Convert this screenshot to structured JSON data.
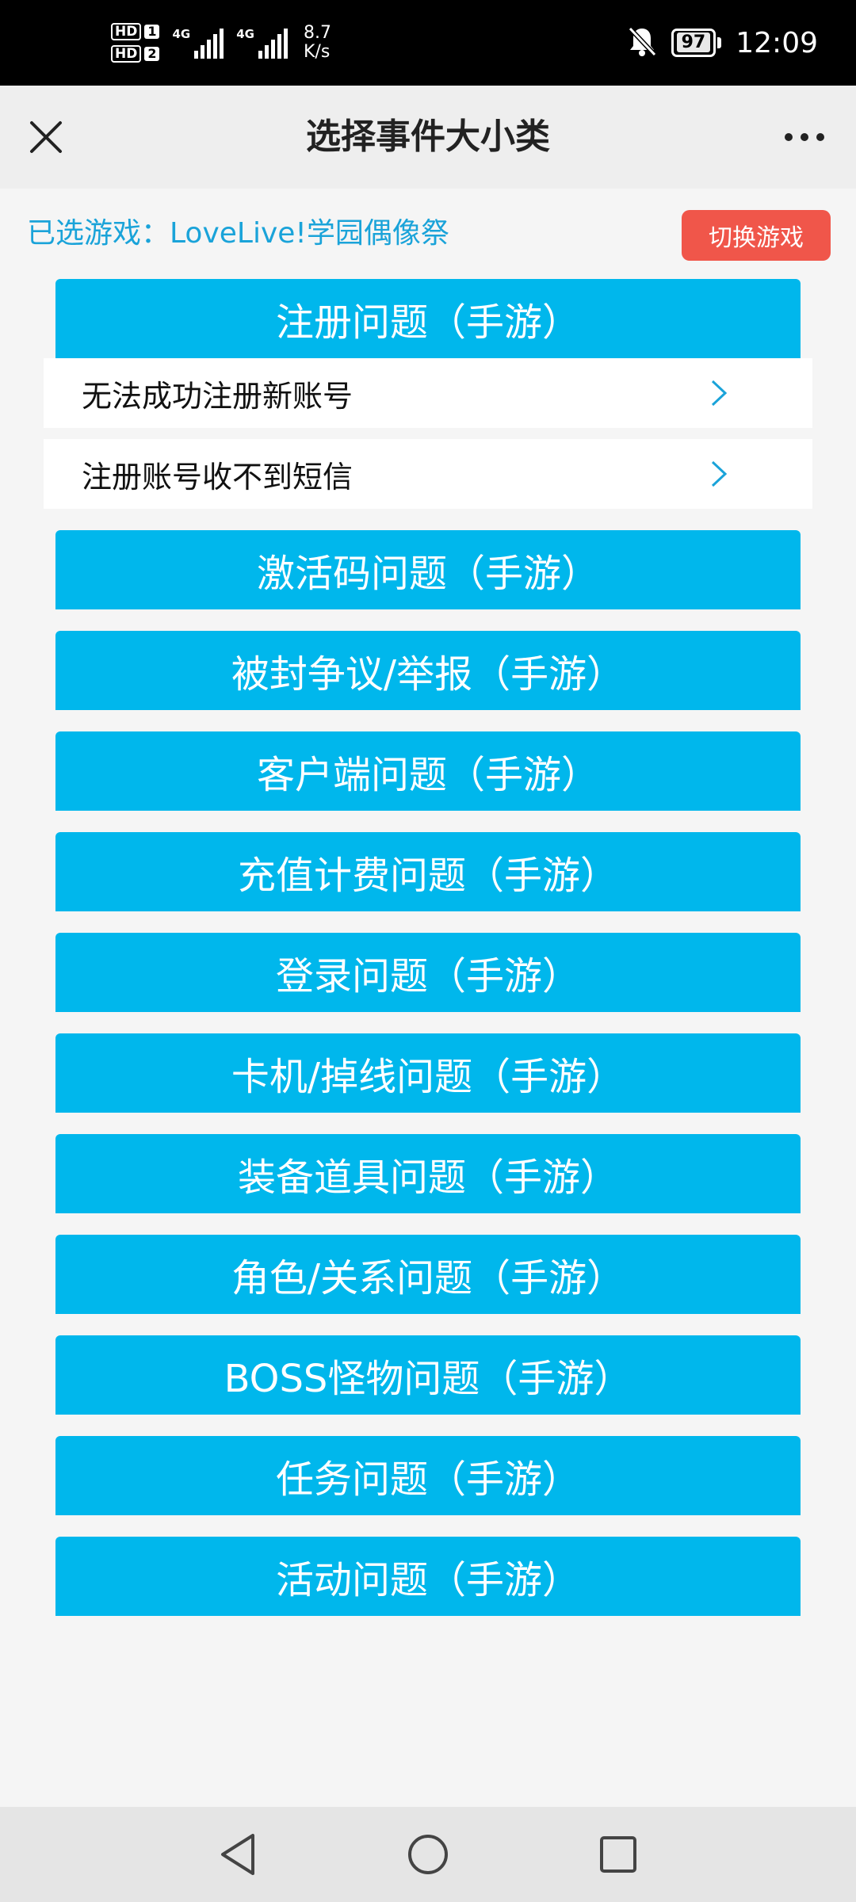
{
  "status_bar": {
    "sim1_tag": "HD",
    "sim1_num": "1",
    "sim2_tag": "HD",
    "sim2_num": "2",
    "network1": "4G",
    "network2": "4G",
    "speed_value": "8.7",
    "speed_unit": "K/s",
    "battery": "97",
    "time": "12:09",
    "icons": [
      "mute-bell-icon",
      "battery-icon"
    ]
  },
  "header": {
    "title": "选择事件大小类",
    "close_icon": "close-icon",
    "more_icon": "more-dots-icon"
  },
  "selected_game": {
    "text": "已选游戏：LoveLive!学园偶像祭",
    "switch_button": "切换游戏",
    "switch_color": "#f0564a"
  },
  "accent_color": "#00b7ec",
  "categories": [
    {
      "label": "注册问题（手游）",
      "expanded": true,
      "items": [
        {
          "label": "无法成功注册新账号"
        },
        {
          "label": "注册账号收不到短信"
        }
      ]
    },
    {
      "label": "激活码问题（手游）"
    },
    {
      "label": "被封争议/举报（手游）"
    },
    {
      "label": "客户端问题（手游）"
    },
    {
      "label": "充值计费问题（手游）"
    },
    {
      "label": "登录问题（手游）"
    },
    {
      "label": "卡机/掉线问题（手游）"
    },
    {
      "label": "装备道具问题（手游）"
    },
    {
      "label": "角色/关系问题（手游）"
    },
    {
      "label": "BOSS怪物问题（手游）"
    },
    {
      "label": "任务问题（手游）"
    },
    {
      "label": "活动问题（手游）"
    }
  ],
  "nav_bar": {
    "icons": [
      "back-triangle-icon",
      "home-circle-icon",
      "recents-square-icon"
    ]
  }
}
